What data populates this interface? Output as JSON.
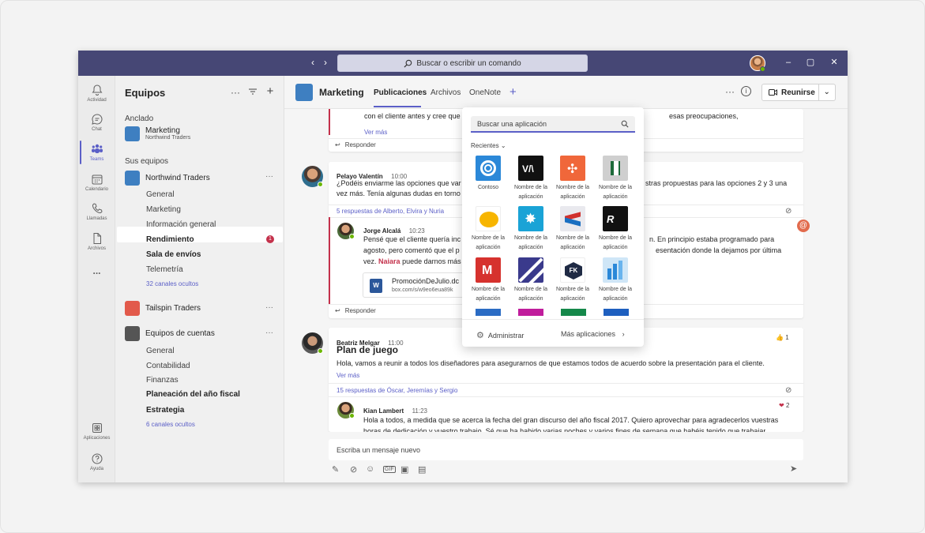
{
  "titlebar": {
    "search_placeholder": "Buscar o escribir un comando",
    "back_icon": "chevron-left-icon",
    "forward_icon": "chevron-right-icon"
  },
  "rail": {
    "items": [
      {
        "label": "Actividad",
        "icon": "bell-icon"
      },
      {
        "label": "Chat",
        "icon": "chat-icon"
      },
      {
        "label": "Teams",
        "icon": "teams-icon"
      },
      {
        "label": "Calendario",
        "icon": "calendar-icon"
      },
      {
        "label": "Llamadas",
        "icon": "phone-icon"
      },
      {
        "label": "Archivos",
        "icon": "file-icon"
      }
    ],
    "more": "...",
    "apps": "Aplicaciones",
    "help": "Ayuda"
  },
  "teams_pane": {
    "title": "Equipos",
    "pinned_label": "Anclado",
    "pinned": {
      "name": "Marketing",
      "sub": "Northwind Traders"
    },
    "your_teams_label": "Sus equipos",
    "teams": [
      {
        "name": "Northwind Traders",
        "channels": [
          {
            "label": "General",
            "style": "normal"
          },
          {
            "label": "Marketing",
            "style": "selected"
          },
          {
            "label": "Información general",
            "style": "normal"
          },
          {
            "label": "Rendimiento",
            "style": "bold",
            "badge": "1"
          },
          {
            "label": "Sala de envíos",
            "style": "bold"
          },
          {
            "label": "Telemetría",
            "style": "normal"
          },
          {
            "label": "32 canales ocultos",
            "style": "link"
          }
        ]
      },
      {
        "name": "Tailspin Traders"
      },
      {
        "name": "Equipos de cuentas",
        "channels": [
          {
            "label": "General",
            "style": "normal"
          },
          {
            "label": "Contabilidad",
            "style": "normal"
          },
          {
            "label": "Finanzas",
            "style": "normal"
          },
          {
            "label": "Planeación del año fiscal",
            "style": "bold"
          },
          {
            "label": "Estrategia",
            "style": "bold"
          },
          {
            "label": "6 canales ocultos",
            "style": "link"
          }
        ]
      }
    ]
  },
  "channel": {
    "title": "Marketing",
    "tabs": [
      "Publicaciones",
      "Archivos",
      "OneNote"
    ],
    "meet_label": "Reunirse"
  },
  "posts": {
    "p0": {
      "text": "con el cliente antes y cree que",
      "text_right": "esas preocupaciones,",
      "see_more": "Ver más",
      "reply": "Responder"
    },
    "p1": {
      "author": "Pelayo Valentín",
      "time": "10:00",
      "line1": "¿Podéis enviarme las opciones que var",
      "line1_right": "stras propuestas para las opciones 2 y 3 una",
      "line2": "vez más. Tenía algunas dudas en torno",
      "replies": "5 respuestas de Alberto, Elvira y Nuria",
      "reply_author": "Jorge Alcalá",
      "reply_time": "10:23",
      "reply_line1": "Pensé que el cliente quería inc",
      "reply_line1_right": "n. En principio estaba programado para",
      "reply_line2": "agosto, pero comentó que el p",
      "reply_line2_right": "esentación donde la dejamos por última",
      "reply_line3_pre": "vez.",
      "reply_mention": "Naiara",
      "reply_line3_post": "puede darnos más",
      "file_name": "PromociónDeJulio.dc",
      "file_url": "box.com/s/w9eo6eua89k",
      "reply": "Responder"
    },
    "p2": {
      "author": "Beatriz Melgar",
      "time": "11:00",
      "title": "Plan de juego",
      "line1": "Hola, vamos a reunir a todos los diseñadores para asegurarnos de que estamos todos de acuerdo sobre la presentación para el cliente.",
      "see_more": "Ver más",
      "like_count": "1",
      "replies": "15 respuestas de Óscar, Jeremías y Sergio",
      "reply_author": "Kian Lambert",
      "reply_time": "11:23",
      "heart_count": "2",
      "reply_line1": "Hola a todos, a medida que se acerca la fecha del gran discurso del año fiscal 2017. Quiero aprovechar para agradecerlos vuestras",
      "reply_line2": "horas de dedicación y vuestro trabajo. Sé que ha habido varias noches y varios fines de semana que habéis tenido que trabajar"
    }
  },
  "compose": {
    "placeholder": "Escriba un mensaje nuevo"
  },
  "flyout": {
    "search_placeholder": "Buscar una aplicación",
    "recent_label": "Recientes",
    "apps": [
      {
        "name": "Contoso",
        "color": "#2b88d8"
      },
      {
        "name": "Nombre de la aplicación",
        "color": "#111111"
      },
      {
        "name": "Nombre de la aplicación",
        "color": "#f0673a"
      },
      {
        "name": "Nombre de la aplicación",
        "color": "#cfcfcf"
      },
      {
        "name": "Nombre de la aplicación",
        "color": "#ffffff"
      },
      {
        "name": "Nombre de la aplicación",
        "color": "#1aa3d6"
      },
      {
        "name": "Nombre de la aplicación",
        "color": "#e9e9ee"
      },
      {
        "name": "Nombre de la aplicación",
        "color": "#111111"
      },
      {
        "name": "Nombre de la aplicación",
        "color": "#d6322e"
      },
      {
        "name": "Nombre de la aplicación",
        "color": "#3a3a8c"
      },
      {
        "name": "Nombre de la aplicación",
        "color": "#ffffff"
      },
      {
        "name": "Nombre de la aplicación",
        "color": "#cfe6f7"
      }
    ],
    "admin_label": "Administrar",
    "more_label": "Más aplicaciones"
  }
}
